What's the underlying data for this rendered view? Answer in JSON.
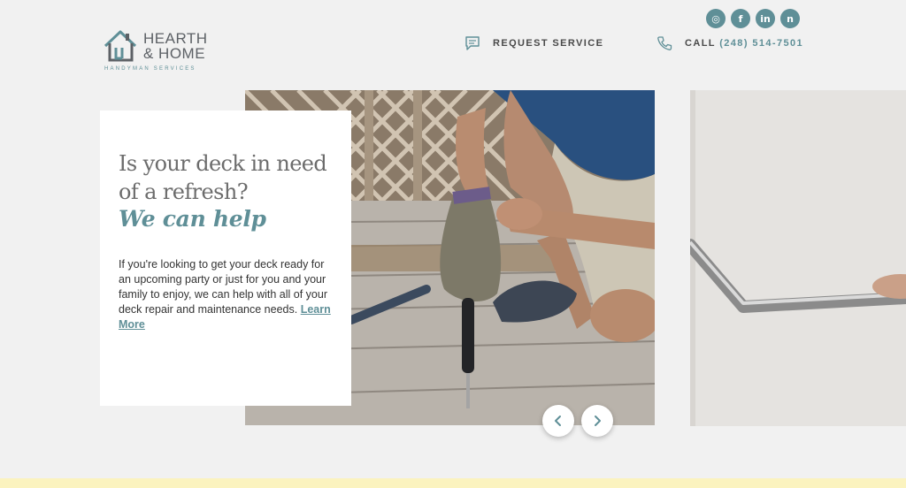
{
  "colors": {
    "accent": "#5f8f97",
    "background": "#f1f1f1",
    "footer_strip": "#fbf3bf"
  },
  "social": [
    {
      "name": "instagram",
      "glyph": "◎"
    },
    {
      "name": "facebook",
      "glyph": "f"
    },
    {
      "name": "linkedin",
      "glyph": "in"
    },
    {
      "name": "nextdoor",
      "glyph": "n"
    }
  ],
  "logo": {
    "line1": "HEARTH",
    "line2": "& HOME",
    "sub": "HANDYMAN SERVICES",
    "icon": "house-icon"
  },
  "nav": {
    "service_label": "REQUEST SERVICE",
    "service_icon": "chat-bubble-icon",
    "call_prefix": "CALL",
    "call_number": "(248) 514-7501",
    "call_icon": "phone-icon"
  },
  "hero": {
    "heading": "Is your deck in need of a refresh?",
    "accent": "We can help",
    "body": "If you're looking to get your deck ready for an upcoming party or just for you and your family to enjoy, we can help with all of your deck repair and maintenance needs. ",
    "link": "Learn More"
  },
  "slider": {
    "prev_icon": "chevron-left-icon",
    "next_icon": "chevron-right-icon"
  }
}
